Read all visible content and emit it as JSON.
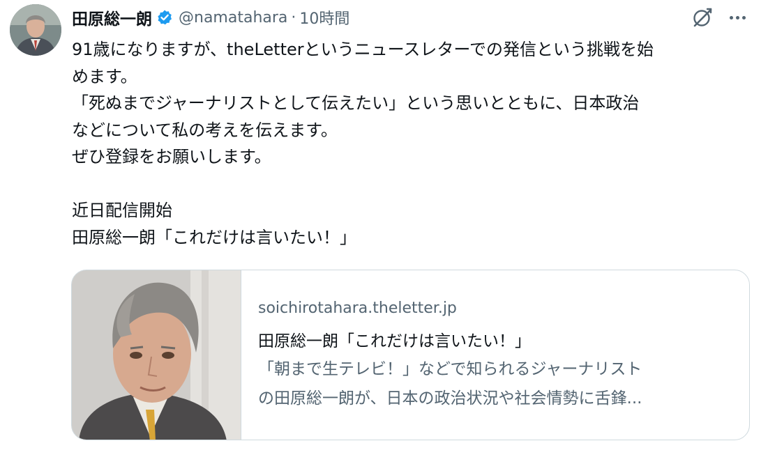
{
  "author": {
    "display_name": "田原総一朗",
    "handle": "@namatahara",
    "separator": "·",
    "timestamp": "10時間",
    "verified": true
  },
  "icons": {
    "verified": "verified-badge-icon",
    "grok": "grok-icon",
    "more": "more-options-icon"
  },
  "colors": {
    "accent": "#1d9bf0",
    "text": "#0f1419",
    "muted": "#536471",
    "border": "#cfd9de"
  },
  "tweet": {
    "lines": [
      "91歳になりますが、theLetterというニュースレターでの発信という挑戦を始",
      "めます。",
      "「死ぬまでジャーナリストとして伝えたい」という思いとともに、日本政治",
      "などについて私の考えを伝えます。",
      "ぜひ登録をお願いします。",
      "",
      "近日配信開始",
      "田原総一朗「これだけは言いたい！」"
    ]
  },
  "card": {
    "domain": "soichirotahara.theletter.jp",
    "title": "田原総一朗「これだけは言いたい！」",
    "description_lines": [
      "「朝まで生テレビ！」などで知られるジャーナリスト",
      "の田原総一朗が、日本の政治状況や社会情勢に舌鋒..."
    ]
  }
}
